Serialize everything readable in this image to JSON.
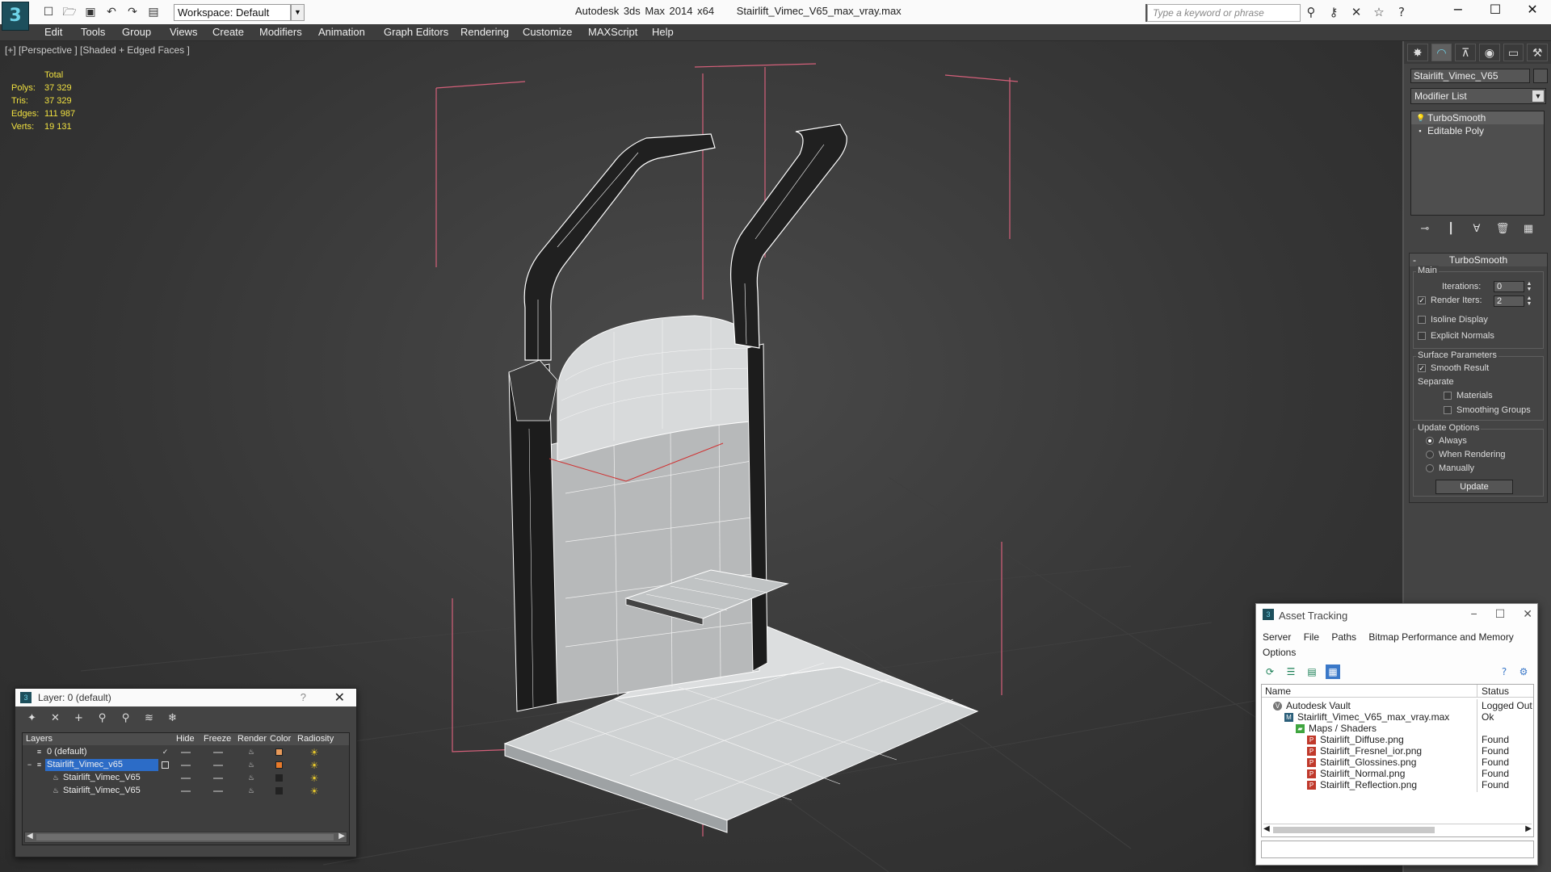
{
  "app": {
    "title": "Autodesk 3ds Max 2014 x64",
    "filename": "Stairlift_Vimec_V65_max_vray.max",
    "workspace": "Workspace: Default",
    "search_placeholder": "Type a keyword or phrase",
    "logo_glyph": "3"
  },
  "menu": [
    "Edit",
    "Tools",
    "Group",
    "Views",
    "Create",
    "Modifiers",
    "Animation",
    "Graph Editors",
    "Rendering",
    "Customize",
    "MAXScript",
    "Help"
  ],
  "viewport": {
    "label": "[+] [Perspective ] [Shaded + Edged Faces ]",
    "stats_header": "Total",
    "stats": [
      {
        "key": "Polys:",
        "value": "37 329"
      },
      {
        "key": "Tris:",
        "value": "37 329"
      },
      {
        "key": "Edges:",
        "value": "111 987"
      },
      {
        "key": "Verts:",
        "value": "19 131"
      }
    ]
  },
  "command_panel": {
    "object_name": "Stairlift_Vimec_V65",
    "modifier_list": "Modifier List",
    "stack": [
      "TurboSmooth",
      "Editable Poly"
    ],
    "rollout_title": "TurboSmooth",
    "main_label": "Main",
    "iterations_label": "Iterations:",
    "iterations_value": "0",
    "render_iters_label": "Render Iters:",
    "render_iters_value": "2",
    "isoline_display": "Isoline Display",
    "explicit_normals": "Explicit Normals",
    "surface_params": "Surface Parameters",
    "smooth_result": "Smooth Result",
    "separate": "Separate",
    "materials": "Materials",
    "smoothing_groups": "Smoothing Groups",
    "update_options": "Update Options",
    "always": "Always",
    "when_rendering": "When Rendering",
    "manually": "Manually",
    "update_button": "Update"
  },
  "layer_window": {
    "title": "Layer: 0 (default)",
    "help": "?",
    "columns": [
      "Layers",
      "Hide",
      "Freeze",
      "Render",
      "Color",
      "Radiosity"
    ],
    "rows": [
      {
        "name": "0 (default)",
        "color": "#e89a5a",
        "active": true
      },
      {
        "name": "Stairlift_Vimec_v65",
        "color": "#e87a2a",
        "selected": true
      },
      {
        "name": "Stairlift_Vimec_V65",
        "color": "#222222",
        "child": true
      },
      {
        "name": "Stairlift_Vimec_V65",
        "color": "#222222",
        "child": true
      }
    ]
  },
  "asset_window": {
    "title": "Asset Tracking",
    "menu": [
      "Server",
      "File",
      "Paths",
      "Bitmap Performance and Memory",
      "Options"
    ],
    "col_name": "Name",
    "col_status": "Status",
    "rows": [
      {
        "name": "Autodesk Vault",
        "status": "Logged Out",
        "indent": 1,
        "icon": "vault"
      },
      {
        "name": "Stairlift_Vimec_V65_max_vray.max",
        "status": "Ok",
        "indent": 2,
        "icon": "max"
      },
      {
        "name": "Maps / Shaders",
        "status": "",
        "indent": 3,
        "icon": "folder"
      },
      {
        "name": "Stairlift_Diffuse.png",
        "status": "Found",
        "indent": 4,
        "icon": "png"
      },
      {
        "name": "Stairlift_Fresnel_ior.png",
        "status": "Found",
        "indent": 4,
        "icon": "png"
      },
      {
        "name": "Stairlift_Glossines.png",
        "status": "Found",
        "indent": 4,
        "icon": "png"
      },
      {
        "name": "Stairlift_Normal.png",
        "status": "Found",
        "indent": 4,
        "icon": "png"
      },
      {
        "name": "Stairlift_Reflection.png",
        "status": "Found",
        "indent": 4,
        "icon": "png"
      }
    ]
  }
}
